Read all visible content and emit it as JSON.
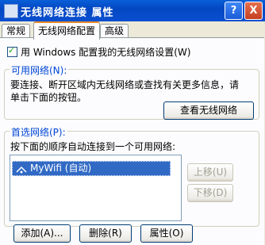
{
  "window": {
    "title": "无线网络连接 属性",
    "help_label": "?",
    "close_label": "X"
  },
  "tabs": [
    "常规",
    "无线网络配置",
    "高级"
  ],
  "use_windows_config": {
    "label": "用 Windows 配置我的无线网络设置(W)",
    "checked": true
  },
  "available": {
    "label": "可用网络(N):",
    "line1": "要连接、断开区域内无线网络或查找有关更多信息，请",
    "line2": "单击下面的按钮。",
    "view_button": "查看无线网络"
  },
  "preferred": {
    "label": "首选网络(P):",
    "desc": "按下面的顺序自动连接到一个可用网络:",
    "items": [
      {
        "text": "MyWifi (自动)"
      }
    ],
    "move_up": "上移(U)",
    "move_down": "下移(D)"
  },
  "bottom_buttons": {
    "add": "添加(A)...",
    "remove": "删除(R)",
    "properties": "属性(O)"
  },
  "colors": {
    "title_bar": "#0a4fd0",
    "selection": "#316ac5",
    "group_label": "#0046d5",
    "tab_highlight": "#e68b2c"
  }
}
